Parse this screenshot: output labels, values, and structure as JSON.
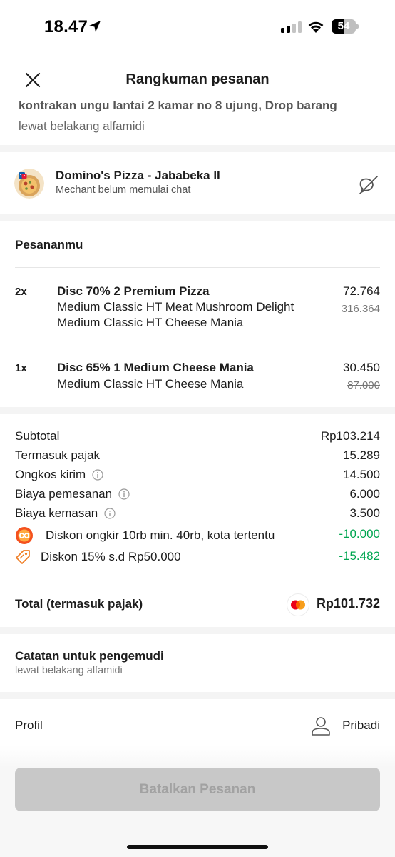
{
  "status_bar": {
    "time": "18.47",
    "battery": "54",
    "battery_level": 0.54
  },
  "header": {
    "title": "Rangkuman pesanan"
  },
  "address": {
    "line1_clipped": "kontrakan ungu lantai 2 kamar no 8 ujung, Drop barang",
    "line2": "lewat belakang alfamidi"
  },
  "merchant": {
    "name": "Domino's Pizza - Jababeka II",
    "status": "Mechant belum memulai chat"
  },
  "order": {
    "title": "Pesananmu",
    "items": [
      {
        "qty": "2x",
        "name": "Disc 70% 2 Premium Pizza",
        "desc": [
          "Medium Classic HT Meat Mushroom Delight",
          "Medium Classic HT Cheese Mania"
        ],
        "price": "72.764",
        "original_price": "316.364"
      },
      {
        "qty": "1x",
        "name": "Disc 65% 1 Medium Cheese Mania",
        "desc": [
          "Medium Classic HT Cheese Mania"
        ],
        "price": "30.450",
        "original_price": "87.000"
      }
    ]
  },
  "summary": {
    "rows": [
      {
        "label": "Subtotal",
        "value": "Rp103.214"
      },
      {
        "label": "Termasuk pajak",
        "value": "15.289"
      },
      {
        "label": "Ongkos kirim",
        "value": "14.500"
      },
      {
        "label": "Biaya pemesanan",
        "value": "6.000"
      },
      {
        "label": "Biaya kemasan",
        "value": "3.500"
      }
    ],
    "discounts": [
      {
        "label": "Diskon ongkir 10rb min. 40rb, kota tertentu",
        "value": "-10.000"
      },
      {
        "label": "Diskon 15% s.d Rp50.000",
        "value": "-15.482"
      }
    ],
    "total_label": "Total (termasuk pajak)",
    "total_value": "Rp101.732"
  },
  "driver_note": {
    "title": "Catatan untuk pengemudi",
    "text": "lewat belakang alfamidi"
  },
  "profile": {
    "label": "Profil",
    "value": "Pribadi"
  },
  "actions": {
    "cancel_label": "Batalkan Pesanan"
  },
  "colors": {
    "discount_green": "#00a651",
    "disabled_button": "#c8c8c8",
    "disabled_text": "#a2a2a2"
  }
}
